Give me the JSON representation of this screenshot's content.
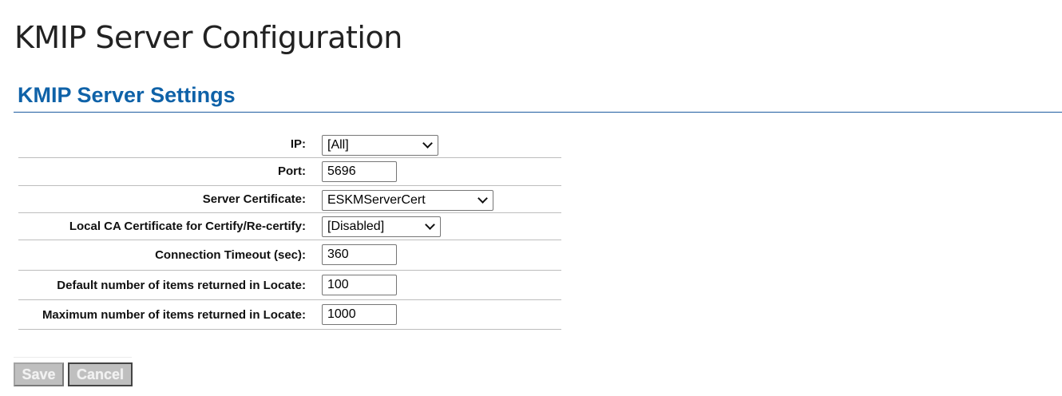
{
  "page": {
    "title": "KMIP Server Configuration",
    "section_title": "KMIP Server Settings"
  },
  "settings": {
    "ip": {
      "label": "IP:",
      "value": "[All]"
    },
    "port": {
      "label": "Port:",
      "value": "5696"
    },
    "server_certificate": {
      "label": "Server Certificate:",
      "value": "ESKMServerCert"
    },
    "local_ca_certificate": {
      "label": "Local CA Certificate for Certify/Re-certify:",
      "value": "[Disabled]"
    },
    "connection_timeout": {
      "label": "Connection Timeout (sec):",
      "value": "360"
    },
    "default_items_locate": {
      "label": "Default number of items returned in Locate:",
      "value": "100"
    },
    "max_items_locate": {
      "label": "Maximum number of items returned in Locate:",
      "value": "1000"
    }
  },
  "actions": {
    "save_label": "Save",
    "cancel_label": "Cancel"
  },
  "colors": {
    "section_title": "#0f62a8",
    "section_rule": "#1d5ca0",
    "disabled_button": "#bfbfbf"
  }
}
